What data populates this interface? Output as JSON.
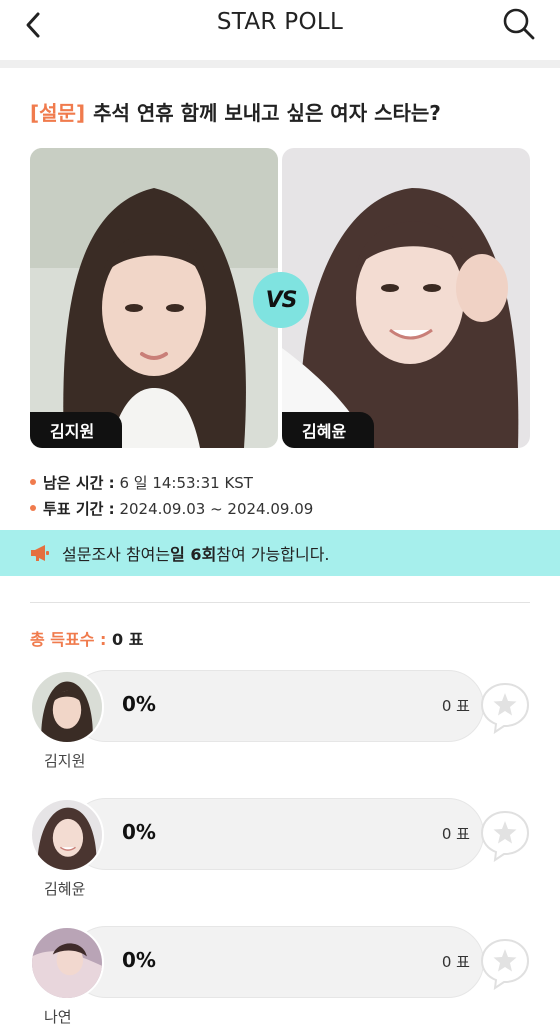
{
  "header": {
    "title": "STAR POLL",
    "back_icon": "chevron-left-icon",
    "search_icon": "search-icon"
  },
  "poll": {
    "tag": "[설문]",
    "question": "추석 연휴 함께 보내고 싶은 여자 스타는?",
    "vs_label": "VS",
    "candidates": [
      {
        "name": "김지원"
      },
      {
        "name": "김혜윤"
      }
    ]
  },
  "info": {
    "remaining_label": "남은 시간 :",
    "remaining_value": "6 일 14:53:31 KST",
    "period_label": "투표 기간 :",
    "period_value": "2024.09.03 ~ 2024.09.09"
  },
  "notice": {
    "icon": "megaphone-icon",
    "text_before": "설문조사 참여는 ",
    "text_bold": "일 6회",
    "text_after": " 참여 가능합니다."
  },
  "totals": {
    "label": "총 득표수 :",
    "value": "0 표"
  },
  "results": [
    {
      "name": "김지원",
      "percent": "0%",
      "votes": "0 표"
    },
    {
      "name": "김혜윤",
      "percent": "0%",
      "votes": "0 표"
    },
    {
      "name": "나연",
      "percent": "0%",
      "votes": "0 표"
    }
  ],
  "colors": {
    "accent": "#f07b4d",
    "notice_bg": "#a6efec",
    "vs_badge": "#7fe3e0"
  }
}
